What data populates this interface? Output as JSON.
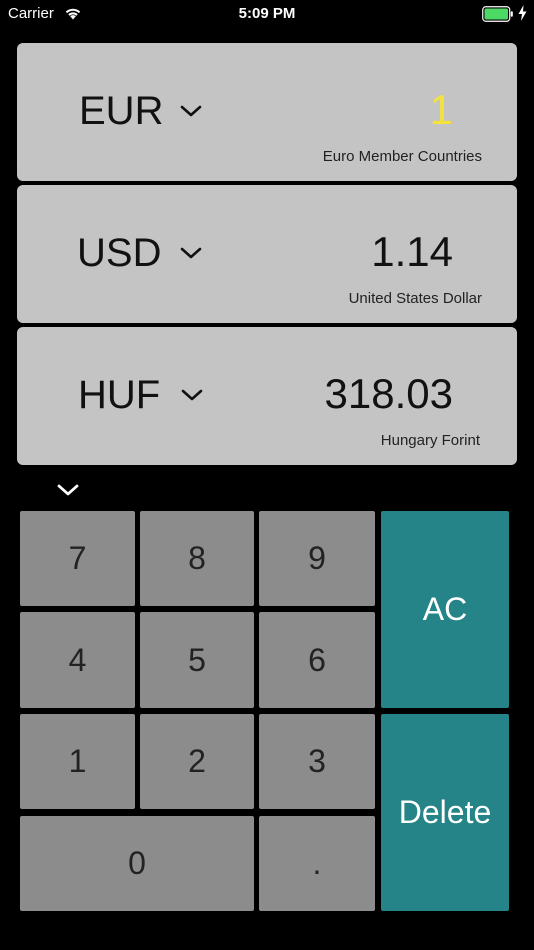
{
  "status_bar": {
    "carrier": "Carrier",
    "time": "5:09 PM",
    "icons": [
      "wifi-icon",
      "battery-icon",
      "charging-icon"
    ]
  },
  "currencies": [
    {
      "code": "EUR",
      "amount": "1",
      "name": "Euro Member Countries",
      "active": true
    },
    {
      "code": "USD",
      "amount": "1.14",
      "name": "United States Dollar",
      "active": false
    },
    {
      "code": "HUF",
      "amount": "318.03",
      "name": "Hungary Forint",
      "active": false
    }
  ],
  "keypad": {
    "digits": {
      "k7": "7",
      "k8": "8",
      "k9": "9",
      "k4": "4",
      "k5": "5",
      "k6": "6",
      "k1": "1",
      "k2": "2",
      "k3": "3",
      "k0": "0",
      "dot": "."
    },
    "clear_label": "AC",
    "delete_label": "Delete"
  },
  "colors": {
    "background": "#000000",
    "card": "#c4c4c4",
    "key": "#8c8c8c",
    "action_key": "#258487",
    "active_amount": "#f5e23a",
    "battery": "#4cd964"
  }
}
